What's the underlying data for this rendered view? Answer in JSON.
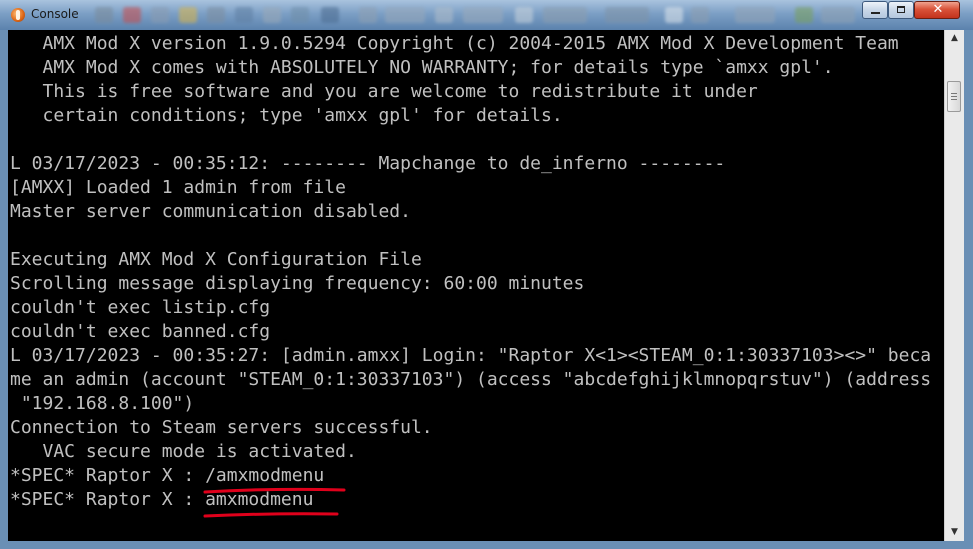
{
  "window": {
    "title": "Console",
    "controls": {
      "minimize_icon": "minimize-icon",
      "maximize_icon": "maximize-icon",
      "close_icon": "close-icon",
      "close_glyph": "✕"
    }
  },
  "console": {
    "text_color": "#c0c0c0",
    "background": "#000000",
    "lines": [
      "   AMX Mod X version 1.9.0.5294 Copyright (c) 2004-2015 AMX Mod X Development Team",
      "   AMX Mod X comes with ABSOLUTELY NO WARRANTY; for details type `amxx gpl'.",
      "   This is free software and you are welcome to redistribute it under",
      "   certain conditions; type 'amxx gpl' for details.",
      "",
      "L 03/17/2023 - 00:35:12: -------- Mapchange to de_inferno --------",
      "[AMXX] Loaded 1 admin from file",
      "Master server communication disabled.",
      "",
      "Executing AMX Mod X Configuration File",
      "Scrolling message displaying frequency: 60:00 minutes",
      "couldn't exec listip.cfg",
      "couldn't exec banned.cfg",
      "L 03/17/2023 - 00:35:27: [admin.amxx] Login: \"Raptor X<1><STEAM_0:1:30337103><>\" beca",
      "me an admin (account \"STEAM_0:1:30337103\") (access \"abcdefghijklmnopqrstuv\") (address",
      " \"192.168.8.100\")",
      "Connection to Steam servers successful.",
      "   VAC secure mode is activated.",
      "*SPEC* Raptor X : /amxmodmenu",
      "*SPEC* Raptor X : amxmodmenu"
    ]
  },
  "annotation": {
    "underline_color": "#e0001b"
  },
  "scrollbar": {
    "up_glyph": "▲",
    "down_glyph": "▼"
  }
}
